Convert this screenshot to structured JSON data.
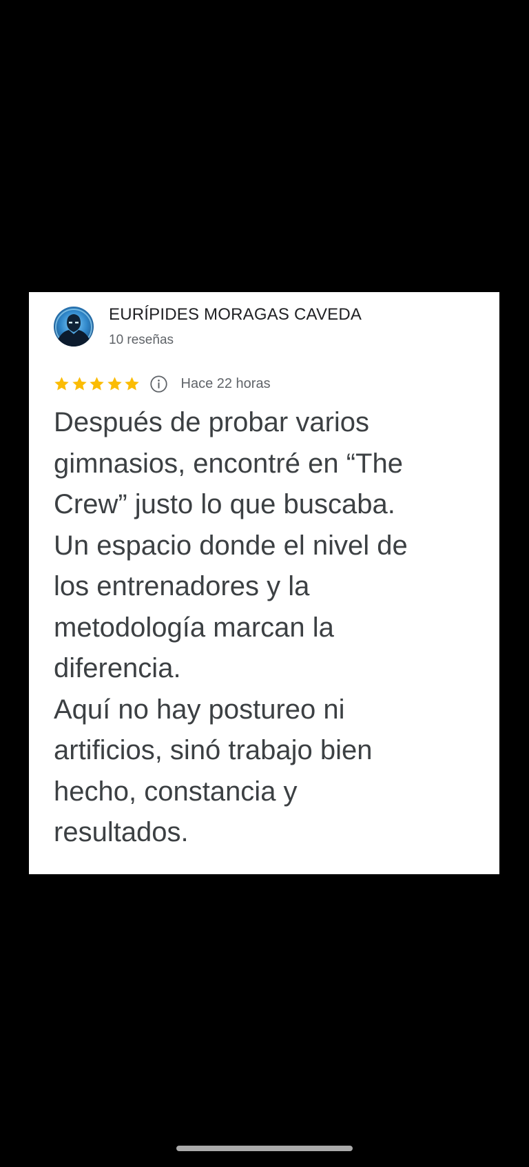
{
  "review": {
    "author_name": "EURÍPIDES MORAGAS CAVEDA",
    "review_count": "10 reseñas",
    "rating": 5,
    "rating_max": 5,
    "time_ago": "Hace 22 horas",
    "icons": {
      "avatar": "profile-avatar",
      "stars": "star-icon",
      "info": "info-icon"
    },
    "colors": {
      "star": "#FBBC04",
      "name": "#202124",
      "secondary": "#5f6368",
      "body": "#3c4043"
    },
    "text_lines": [
      "Después de probar varios",
      "gimnasios, encontré en “The",
      "Crew” justo lo que buscaba.",
      "Un espacio donde el nivel de",
      "los entrenadores y la",
      "metodología marcan la",
      "diferencia.",
      "Aquí no hay postureo ni",
      "artificios, sinó trabajo bien",
      "hecho, constancia y",
      "resultados."
    ]
  }
}
